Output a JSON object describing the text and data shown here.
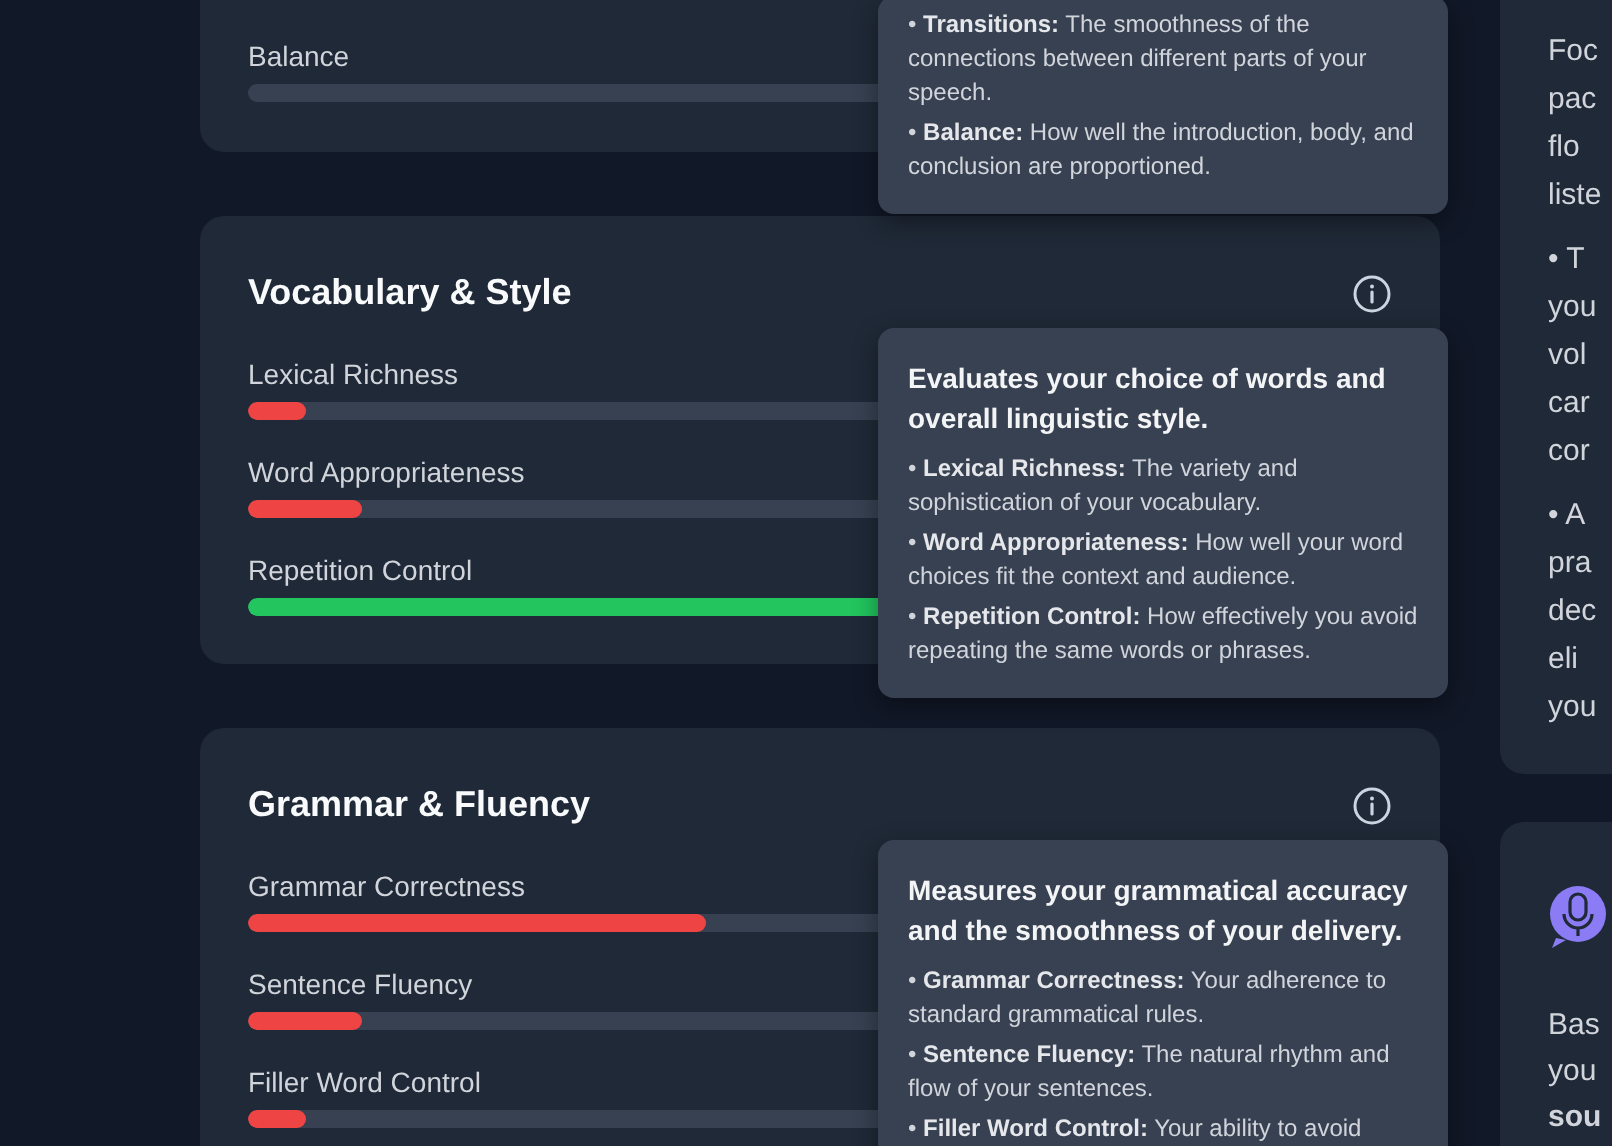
{
  "sections": [
    {
      "metrics": [
        {
          "name": "Balance",
          "level": 0
        }
      ],
      "tooltip": {
        "items": [
          "• **Transitions:** The smoothness of the connections between different parts of your speech.",
          "• **Balance:** How well the introduction, body, and conclusion are proportioned."
        ]
      }
    },
    {
      "title": "Vocabulary & Style",
      "metrics": [
        {
          "name": "Lexical Richness",
          "level": 0.05
        },
        {
          "name": "Word Appropriateness",
          "level": 0.1
        },
        {
          "name": "Repetition Control",
          "level": 0.6
        }
      ],
      "tooltip": {
        "heading": "Evaluates your choice of words and overall linguistic style.",
        "items": [
          "• **Lexical Richness:** The variety and sophistication of your vocabulary.",
          "• **Word Appropriateness:** How well your word choices fit the context and audience.",
          "• **Repetition Control:** How effectively you avoid repeating the same words or phrases."
        ]
      }
    },
    {
      "title": "Grammar & Fluency",
      "metrics": [
        {
          "name": "Grammar Correctness",
          "level": 0.4
        },
        {
          "name": "Sentence Fluency",
          "level": 0.1
        },
        {
          "name": "Filler Word Control",
          "level": 0.05
        }
      ],
      "tooltip": {
        "heading": "Measures your grammatical accuracy and the smoothness of your delivery.",
        "items": [
          "• **Grammar Correctness:** Your adherence to standard grammatical rules.",
          "• **Sentence Fluency:** The natural rhythm and flow of your sentences.",
          "• **Filler Word Control:** Your ability to avoid"
        ]
      }
    }
  ],
  "side_tips": [
    "Foc\npac\nflo\nliste",
    "• T\nyou\nvol\ncar\ncor",
    "• A\npra\ndec\neli\nyou"
  ],
  "side_card": {
    "text": "Bas\nyou\n**sou**"
  }
}
